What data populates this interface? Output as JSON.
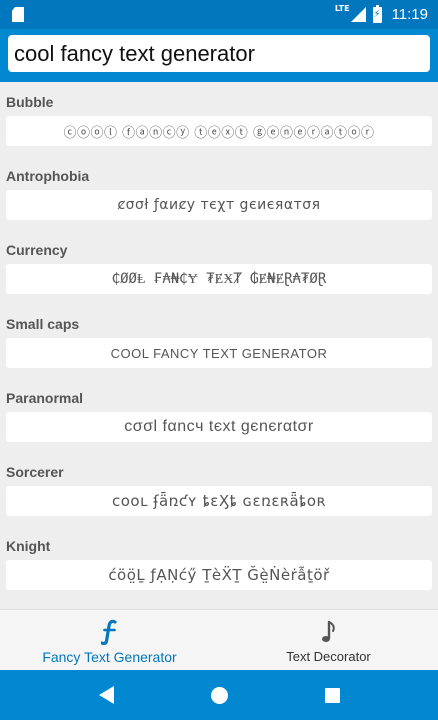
{
  "status_bar": {
    "network": "LTE",
    "time": "11:19",
    "icons": [
      "sd-card-icon",
      "signal-icon",
      "battery-charging-icon"
    ]
  },
  "search": {
    "value": "cool fancy text generator",
    "placeholder": ""
  },
  "styles": [
    {
      "label": "Bubble",
      "text": "ⓒⓞⓞⓛ ⓕⓐⓝⓒⓨ ⓣⓔⓧⓣ ⓖⓔⓝⓔⓡⓐⓣⓞⓡ"
    },
    {
      "label": "Antrophobia",
      "text": "ȼσσł ƒαиȼу тєχт gєиєяαтσя"
    },
    {
      "label": "Currency",
      "text": "₵ØØⱠ ₣₳₦₵Ɏ ₮ɆӾȾ ₲Ɇ₦ɆⱤ₳₮ØⱤ"
    },
    {
      "label": "Small caps",
      "text": "COOL FANCY TEXT GENERATOR"
    },
    {
      "label": "Paranormal",
      "text": "cσσl fαncч tєxt gєnєrαtσr"
    },
    {
      "label": "Sorcerer",
      "text": "ᴄᴏᴏʟ ʄǟռƈʏ ȶɛӼȶ ɢɛռɛʀǟȶօʀ"
    },
    {
      "label": "Knight",
      "text": "ćöö̤Ḻ ƒẠṆćӳ ṮèẌṮ Ğè̤Ṅèṙẫṯöř"
    }
  ],
  "bottom_nav": {
    "items": [
      {
        "label": "Fancy Text Generator",
        "icon": "fancy-f-icon",
        "active": true
      },
      {
        "label": "Text Decorator",
        "icon": "text-decorator-icon",
        "active": false
      }
    ]
  },
  "system_nav": {
    "buttons": [
      "back",
      "home",
      "recents"
    ]
  },
  "colors": {
    "primary": "#0288d1",
    "primary_dark": "#0277bd",
    "background": "#eeeeee",
    "card": "#ffffff"
  }
}
